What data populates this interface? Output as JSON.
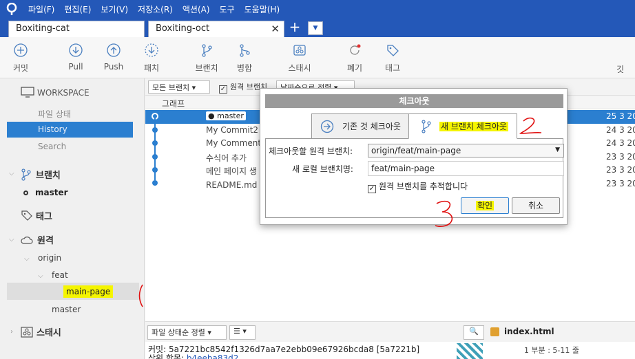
{
  "menu": [
    "파일(F)",
    "편집(E)",
    "보기(V)",
    "저장소(R)",
    "액션(A)",
    "도구",
    "도움말(H)"
  ],
  "tabs": [
    {
      "label": "Boxiting-cat"
    },
    {
      "label": "Boxiting-oct",
      "close": "✕"
    }
  ],
  "tab_add": "+",
  "tab_dropdown": "▼",
  "toolbar": {
    "commit": "커밋",
    "pull": "Pull",
    "push": "Push",
    "patch": "패치",
    "branch": "브랜치",
    "merge": "병합",
    "stash": "스태시",
    "discard": "폐기",
    "tag": "태그",
    "overflow": "깃"
  },
  "sidebar": {
    "workspace": "WORKSPACE",
    "file_status": "파일 상태",
    "history": "History",
    "search": "Search",
    "branches": "브랜치",
    "master": "master",
    "tags": "태그",
    "remote": "원격",
    "origin": "origin",
    "feat": "feat",
    "main_page": "main-page",
    "origin_master": "master",
    "stash": "스태시"
  },
  "filterbar": {
    "all_branches": "모든 브랜치",
    "remote_branch": "원격 브랜치",
    "sort": "날짜순으로 정렬"
  },
  "columns": {
    "graph": "그래프"
  },
  "commits": [
    {
      "message": "master",
      "date": "25 3 20"
    },
    {
      "message": "My Commit2",
      "date": "24 3 20"
    },
    {
      "message": "My Comment",
      "date": "24 3 20"
    },
    {
      "message": "수식어 추가",
      "date": "23 3 20"
    },
    {
      "message": "메인 페이지 생",
      "date": "23 3 20"
    },
    {
      "message": "README.md 추",
      "date": "23 3 20"
    }
  ],
  "bottom": {
    "file_sort": "파일 상태순 정렬",
    "file_name": "index.html",
    "hunk": "1 부분 : 5-11 줄"
  },
  "commit_info": {
    "commit_line": "커밋: 5a7221bc8542f1326d7aa7e2ebb09e67926bcda8 [5a7221b]",
    "parent_label": "상위 항목:",
    "parent_hash": "b4eeba83d2"
  },
  "dialog": {
    "title": "체크아웃",
    "tab_existing": "기존 것 체크아웃",
    "tab_new": "새 브랜치 체크아웃",
    "remote_label": "체크아웃할 원격 브랜치:",
    "remote_value": "origin/feat/main-page",
    "local_label": "새 로컬 브랜치명:",
    "local_value": "feat/main-page",
    "track_label": "원격 브랜치를 추적합니다",
    "ok": "확인",
    "cancel": "취소"
  },
  "colors": {
    "accent": "#2458b8",
    "selection": "#2b7fd0",
    "highlight": "#f5f500",
    "annotation": "#e01010"
  }
}
